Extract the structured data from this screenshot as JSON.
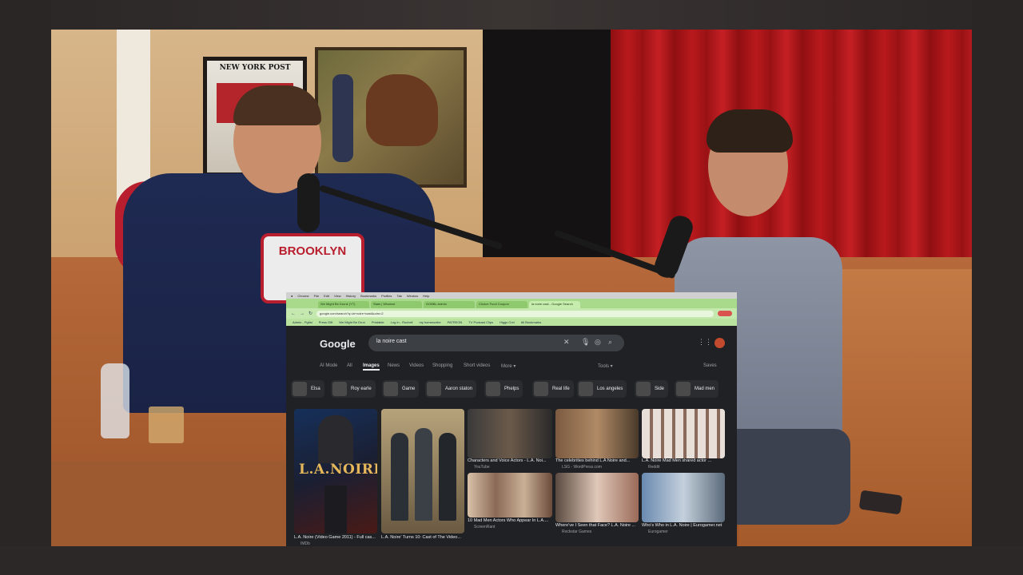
{
  "browser": {
    "menu": [
      "Chrome",
      "File",
      "Edit",
      "View",
      "History",
      "Bookmarks",
      "Profiles",
      "Tab",
      "Window",
      "Help"
    ],
    "tabs": [
      "We Might Be Drunk (YT)",
      "Stats | Whatnot",
      "GOBBL Admin",
      "Choice Food Coupon",
      "la noire cast - Google Search"
    ],
    "url": "google.com/search?q=la+noire+cast&udm=2",
    "bookmarks": [
      "Admin - Pglist",
      "Press Gift",
      "We Might Be Drun",
      "Printable",
      "Log in - Rochell",
      "my homescribe",
      "PATREON",
      "TV Podcast Clips",
      "Higgs Crel",
      "All Bookmarks"
    ]
  },
  "google": {
    "logo": "Google",
    "query": "la noire cast",
    "nav": [
      "AI Mode",
      "All",
      "Images",
      "News",
      "Videos",
      "Shopping",
      "Short videos",
      "More ▾"
    ],
    "tools": "Tools ▾",
    "saves": "Saves",
    "chips": [
      "Elsa",
      "Roy earle",
      "Game",
      "Aaron staton",
      "Phelps",
      "Real life",
      "Los angeles",
      "Side",
      "Mad men"
    ],
    "results": [
      {
        "poster_text": "L.A.NOIRE",
        "caption": "L.A. Noire (Video Game 2011) - Full cas...",
        "source": "IMDb"
      },
      {
        "caption": "L.A. Noire' Turns 10: Cast of The Video...",
        "source": ""
      },
      {
        "caption": "Characters and Voice Actors - L.A. Noi...",
        "source": "YouTube"
      },
      {
        "caption": "The celebrities behind L.A Noire and...",
        "source": "LSG - WordPress.com"
      },
      {
        "caption": "L.A. Noire Mad Men shared actor ...",
        "source": "Reddit"
      },
      {
        "caption": "10 Mad Men Actors Who Appear In L.A....",
        "source": "ScreenRant"
      },
      {
        "caption": "Where've I Seen that Face? L.A. Noire ...",
        "source": "Rockstar Games"
      },
      {
        "caption": "Who's Who in L.A. Noire | Eurogamer.net",
        "source": "Eurogamer"
      }
    ]
  },
  "studio": {
    "jersey_text": "BROOKLYN",
    "poster_text": "NEW YORK POST"
  }
}
